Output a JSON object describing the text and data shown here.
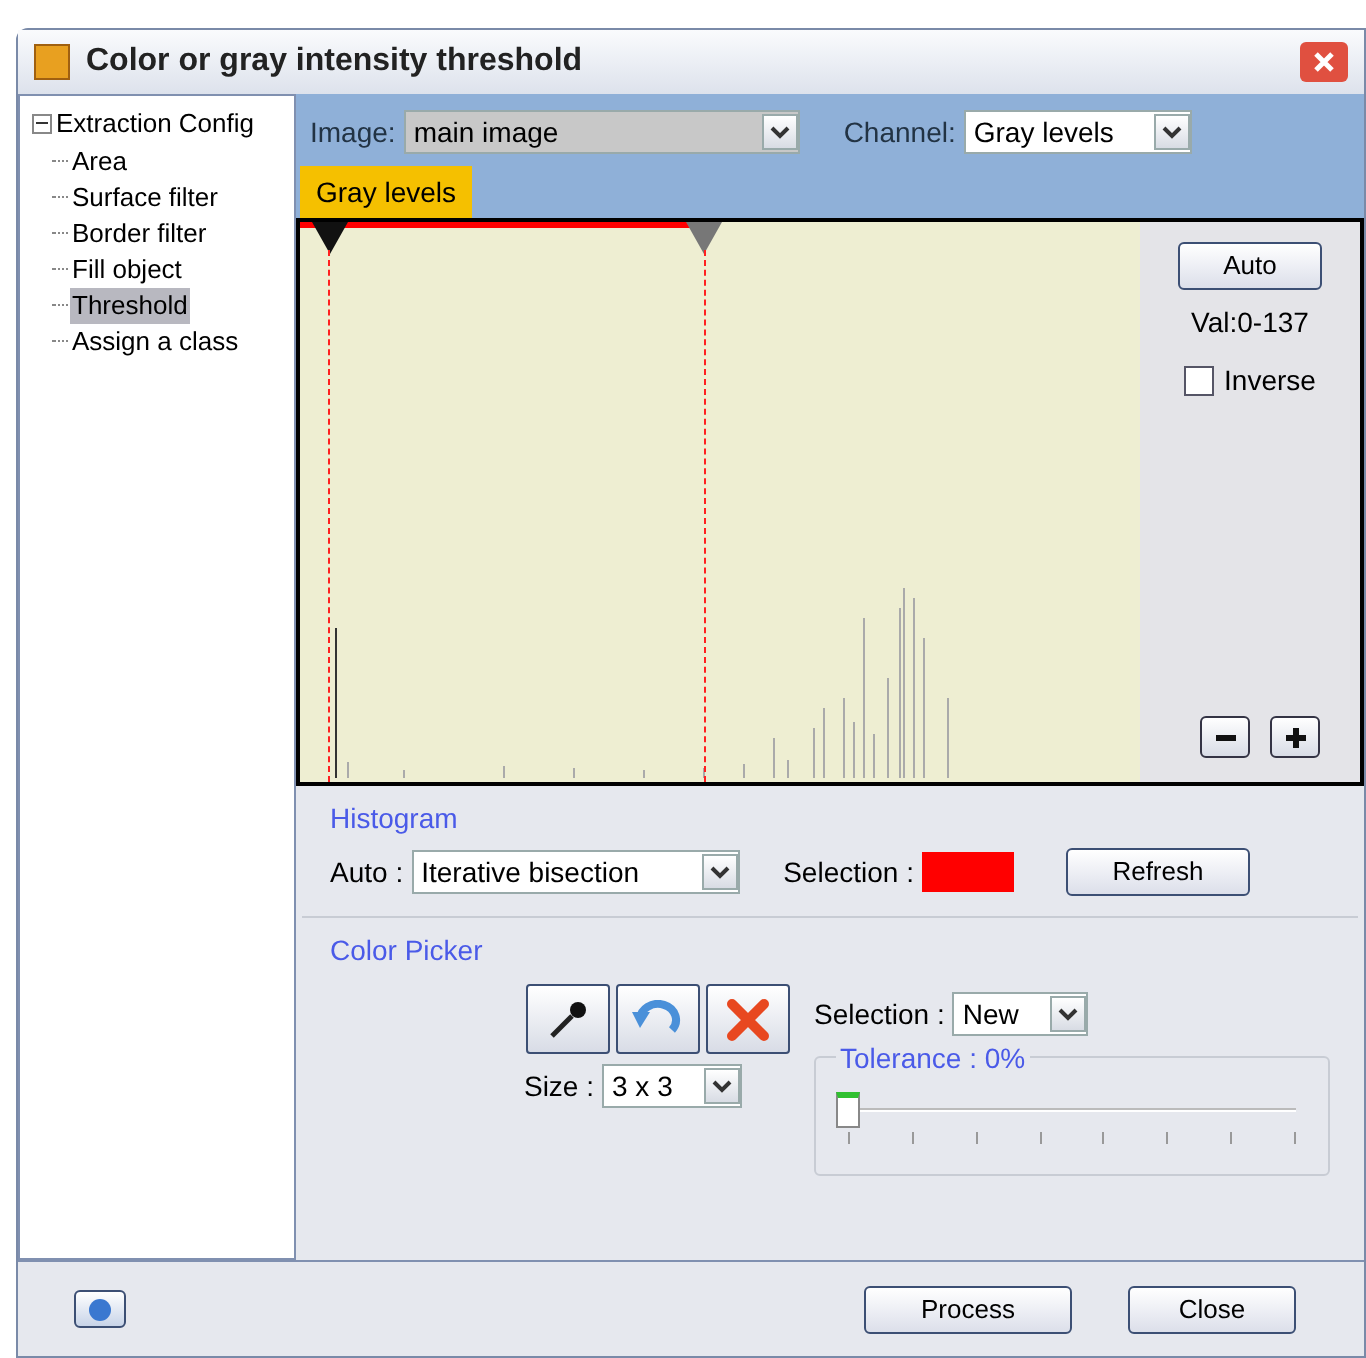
{
  "window": {
    "title": "Color or gray intensity threshold"
  },
  "tree": {
    "label": "Extraction Config",
    "expanded": true,
    "children": [
      {
        "label": "Area",
        "selected": false
      },
      {
        "label": "Surface filter",
        "selected": false
      },
      {
        "label": "Border filter",
        "selected": false
      },
      {
        "label": "Fill object",
        "selected": false
      },
      {
        "label": "Threshold",
        "selected": true
      },
      {
        "label": "Assign a class",
        "selected": false
      }
    ]
  },
  "image_select": {
    "label": "Image:",
    "value": "main image"
  },
  "channel_select": {
    "label": "Channel:",
    "value": "Gray levels"
  },
  "tabs": [
    {
      "label": "Gray levels",
      "selected": true
    }
  ],
  "histogram": {
    "range": {
      "level": 0.48
    },
    "auto_button": "Auto",
    "value_text": "Val:0-137",
    "inverse": {
      "label": "Inverse",
      "checked": false
    }
  },
  "histogram_section": {
    "title": "Histogram",
    "auto_label": "Auto :",
    "auto_value": "Iterative bisection",
    "selection_label": "Selection :",
    "selection_swatch": {
      "color": "#ff0000"
    },
    "refresh": "Refresh"
  },
  "color_picker": {
    "title": "Color Picker",
    "selection_label": "Selection :",
    "selection_value": "New",
    "size_label": "Size :",
    "size_value": "3 x 3",
    "tolerance": {
      "label": "Tolerance : 0%",
      "level": 0
    }
  },
  "buttons": [
    "Process",
    "Close"
  ]
}
